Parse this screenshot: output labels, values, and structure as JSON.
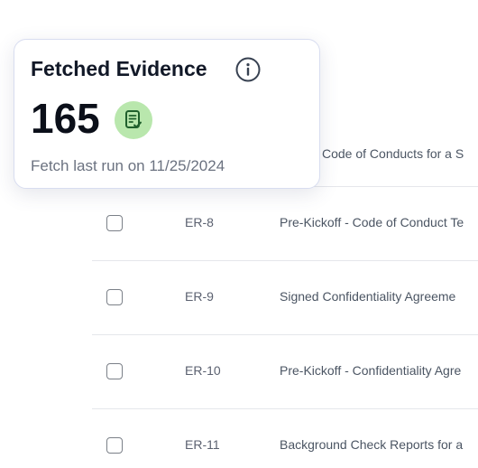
{
  "table": {
    "header_title": "Code of Conducts for a S",
    "rows": [
      {
        "id": "ER-8",
        "title": "Pre-Kickoff - Code of Conduct Te"
      },
      {
        "id": "ER-9",
        "title": "Signed Confidentiality Agreeme"
      },
      {
        "id": "ER-10",
        "title": "Pre-Kickoff - Confidentiality Agre"
      },
      {
        "id": "ER-11",
        "title": "Background Check Reports for a"
      }
    ]
  },
  "card": {
    "title": "Fetched Evidence",
    "count": "165",
    "fetch_text": "Fetch last run on 11/25/2024",
    "info_icon": "info-icon",
    "doc_icon": "document-check-icon",
    "badge_color": "#b9e7ad"
  }
}
